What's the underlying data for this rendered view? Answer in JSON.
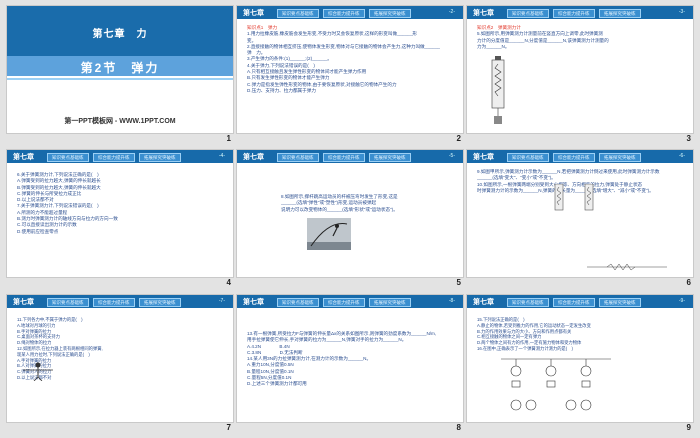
{
  "slides": [
    {
      "number": "1",
      "chapter": "第七章　力",
      "section": "第2节　弹力",
      "site": "第一PPT模板网 - WWW.1PPT.COM"
    },
    {
      "number": "2",
      "chapter": "第七章",
      "tabs": [
        "知识要点基础练",
        "综合能力提升练",
        "拓展探究突破练"
      ],
      "page": "-2-",
      "lines": [
        "知识点1　弹力",
        "1.用力拉橡皮筋,橡皮筋会发生形变,不受力时又会恢复原状,这样的形变叫做______形",
        "变。",
        "2.直接接触的物体相互挤压,使物体发生形变,物体对与它接触的物体会产生力,这种力叫做______",
        "弹　力。",
        "3.产生弹力的条件:(1)______;(2)______。",
        "4.关于弹力,下列说法错误的是(　)",
        "A.只有相互接触且发生弹性形变的物体间才能产生弹力作用",
        "B.只有发生弹性形变的物体才能产生弹力",
        "C.弹力是指发生弹性形变的物体,由于要恢复原状,对接触它的物体产生的力",
        "D.压力、支持力、拉力都属于弹力"
      ]
    },
    {
      "number": "3",
      "chapter": "第七章",
      "tabs": [
        "知识要点基础练",
        "综合能力提升练",
        "拓展探究突破练"
      ],
      "page": "-3-",
      "lines": [
        "知识点2　弹簧测力计",
        "5.如图所示,用弹簧测力计测量前在竖直方向上调零,此时弹簧测",
        "力计的分度值是______N,分度值是______N,该弹簧测力计测量的",
        "力为______N。"
      ]
    },
    {
      "number": "4",
      "chapter": "第七章",
      "tabs": [
        "知识要点基础练",
        "综合能力提升练",
        "拓展探究突破练"
      ],
      "page": "-4-",
      "lines": [
        "6.关于弹簧测力计,下列说法正确的是(　)",
        "A.弹簧受到的拉力越大,弹簧的伸长就越长",
        "B.弹簧受到的拉力越大,弹簧的伸长就越大",
        "C.弹簧的伸长与所受拉力成正比",
        "D.以上说法都不对",
        "7.关于弹簧测力计,下列说法错误的是(　)",
        "A.所测的力不能超过量程",
        "B.测力时弹簧测力计的轴线方向与拉力的方向一致",
        "C.可以直接读出测力计的示数",
        "D.使用前应检查零点"
      ]
    },
    {
      "number": "5",
      "chapter": "第七章",
      "tabs": [
        "知识要点基础练",
        "综合能力提升练",
        "拓展探究突破练"
      ],
      "page": "-5-",
      "lines": [
        "8.如图所示,撑杆跳高运动员的杆被压弯时发生了形变,这是",
        "______(选填\"弹性\"或\"塑性\")形变,运动员被弹起",
        "说明力可以改变物体的______(选填\"形状\"或\"运动状态\")。"
      ]
    },
    {
      "number": "6",
      "chapter": "第七章",
      "tabs": [
        "知识要点基础练",
        "综合能力提升练",
        "拓展探究突破练"
      ],
      "page": "-6-",
      "lines": [
        "9.如图甲所示,弹簧测力计示数为______N,若把弹簧测力计倒过来使用,此时弹簧测力计示数",
        "______(选填\"变大\"、\"变小\"或\"不变\")。",
        "",
        "",
        "",
        "",
        "10.如图所示,一根弹簧两端分别受到大小相等、方向相反的拉力,弹簧处于静止状态",
        "时弹簧测力计的示数为______N,弹簧的伸长量为______(选填\"增大\"、\"减小\"或\"不变\")。"
      ]
    },
    {
      "number": "7",
      "chapter": "第七章",
      "tabs": [
        "知识要点基础练",
        "综合能力提升练",
        "拓展探究突破练"
      ],
      "page": "-7-",
      "lines": [
        "11.下列各力中,不属于弹力的是(　)",
        "A.地球对月球的引力",
        "B.手对弹簧的拉力",
        "C.桌面对茶杯的支持力",
        "D.绳对物体的拉力",
        "12.如图所示,在拉力器上装有两根相同的弹簧,",
        "现某人用力拉时,下列说法正确的是(　)",
        "",
        "",
        "",
        "A.手对弹簧的拉力",
        "B.人对弹簧的拉力",
        "C.弹簧对人的拉力",
        "D.以上说法都不对"
      ]
    },
    {
      "number": "8",
      "chapter": "第七章",
      "tabs": [
        "知识要点基础练",
        "综合能力提升练",
        "拓展探究突破练"
      ],
      "page": "-8-",
      "lines": [
        "13.有一根弹簧,所受拉力F与弹簧的伸长量Δx的关系如图所示,则弹簧的劲度系数为______N/m,",
        "用手拉弹簧使它伸长,手对弹簧的拉力为______N,弹簧对手的拉力为______N。",
        "A.4.2N　　　　B.4N",
        "C.3.8N　　　　D.无法判断",
        "14.某人用3N的力拉弹簧测力计,在测力计的示数为______N。",
        "A.重力10N,分度值0.5N",
        "B.量程10N,分度值0.1N",
        "C.量程5N,分度值0.1N",
        "D.上述三个弹簧测力计都可用"
      ]
    },
    {
      "number": "9",
      "chapter": "第七章",
      "tabs": [
        "知识要点基础练",
        "综合能力提升练",
        "拓展探究突破练"
      ],
      "page": "-9-",
      "lines": [
        "15.下列说法正确的是(　)",
        "A.静止的物体,若受到推力的作用,它的运动状态一定发生改变",
        "B.力的作用效果与力的大小、方向和作用点都有关",
        "C.相互接触的物体之间一定有弹力",
        "D.两个物体之间有力的作用,一定有施力物体和受力物体",
        "16.在图中,正确表示了一个弹簧测力计测力的是(　)"
      ]
    }
  ]
}
